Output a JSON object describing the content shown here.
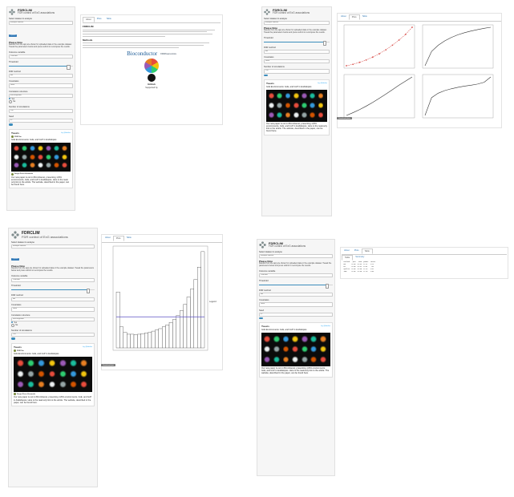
{
  "app": {
    "title": "FDRCLIM",
    "subtitle": "FDR control of ExG associations"
  },
  "sidebar": {
    "dataset_label": "Select dataset to analyse",
    "dataset_value": "Example dataset",
    "upload_button": "Upload",
    "about_heading": "Please Note",
    "about_text": "Results from the app are shown for uploaded data or the example dataset. Tweak the parameters below and press submit to recompute the results.",
    "outcome_label": "Outcome variable",
    "outcome_hint": "Choose the outcome",
    "outcome_value": "Outcome",
    "exposure_label": "Exposure",
    "threshold_label": "Threshold",
    "threshold_value": "0.05",
    "method_label": "FDR method",
    "method_value": "BH",
    "covariates_label": "Covariates",
    "covariates_value": "None",
    "correlation_label": "Correlation structure",
    "correlation_value": "Exchangeable",
    "radio_yes": "Yes",
    "radio_no": "No",
    "nsim_label": "Number of simulations",
    "nsim_value": "100",
    "seed_label": "Seed",
    "seed_value": "42",
    "toggle_label": "Plot",
    "run_label": "Run"
  },
  "tweets": {
    "header": "Tweets",
    "by": "by @fdrclim",
    "tweet1_name": "FDRClim",
    "tweet1_handle": "@fdrclim",
    "tweet1_text": "GxE Environments: GxE, and GxP in Arabidopsis",
    "tweet1_link": "pubmed.ncbi.nlm.nih.gov",
    "tweet1_meta": "12:00 PM",
    "tweet2_name": "Sergio Perez-Hernando",
    "tweet2_handle": "@sperez",
    "tweet2_text": "Our new paper is out in #FrontGenet, presenting 1,801 environments, GxE, and GxP in Arabidopsis. Here is the read-only link to the article. The website, described in the paper, can be found here."
  },
  "q1": {
    "tabs": [
      "About",
      "Plots",
      "Table"
    ],
    "main_heading": "FDRCLIM",
    "about_h2": "Methods",
    "bioc_label": "Bioconductor",
    "ensembl": "FDRGenomics",
    "citation_heading": "Cite this work",
    "github_label": "GitHub",
    "supported_heading": "Supported by"
  },
  "q2": {
    "tabs": [
      "About",
      "Plots",
      "Table"
    ],
    "download_label": "Download plots"
  },
  "q3": {
    "tabs": [
      "About",
      "Plots",
      "Table"
    ],
    "download_label": "Download plot",
    "legend_title": "Legend"
  },
  "q4": {
    "tabs": [
      "About",
      "Plots",
      "Table"
    ],
    "subtabs": [
      "Table",
      "Summary"
    ],
    "table_rows": [
      "  Method   pi0   FDR  power  nDisc",
      "  BH      0.86  0.04  0.71   124",
      "  BY      0.86  0.01  0.52    88",
      "  qvalue  0.86  0.05  0.74   131",
      "  IHW     0.86  0.05  0.78   140"
    ]
  },
  "chart_data": [
    {
      "type": "line",
      "panel": "top-left",
      "x": [
        0,
        1,
        2,
        3,
        4,
        5,
        6,
        7,
        8,
        9,
        10
      ],
      "y": [
        0,
        0.5,
        1.2,
        2,
        3,
        4.2,
        5.6,
        7.2,
        9,
        11,
        13.5
      ],
      "color": "#d9534f"
    },
    {
      "type": "line",
      "panel": "top-right",
      "x": [
        0,
        1,
        2,
        3,
        4,
        5,
        6,
        7,
        8,
        9,
        10
      ],
      "y": [
        0,
        4.2,
        6,
        7.3,
        8.3,
        9.1,
        9.7,
        10.2,
        10.6,
        11,
        11.3
      ],
      "color": "#333333"
    },
    {
      "type": "line",
      "panel": "bottom-left",
      "x": [
        0,
        1,
        2,
        3,
        4,
        5,
        6,
        7,
        8,
        9,
        10
      ],
      "y": [
        0,
        0.8,
        1.7,
        2.7,
        3.8,
        5,
        6.2,
        7.5,
        8.8,
        10,
        11.2
      ],
      "color": "#333333"
    },
    {
      "type": "line",
      "panel": "bottom-right",
      "x": [
        0,
        1,
        2,
        3,
        4,
        5,
        6,
        7,
        8,
        9,
        10
      ],
      "y": [
        0,
        6,
        7.5,
        8.4,
        9,
        9.5,
        9.9,
        10.2,
        10.6,
        11.2,
        13
      ],
      "color": "#333333"
    },
    {
      "type": "bar",
      "panel": "histogram",
      "categories": [
        "1",
        "2",
        "3",
        "4",
        "5",
        "6",
        "7",
        "8",
        "9",
        "10",
        "11",
        "12",
        "13",
        "14",
        "15",
        "16",
        "17",
        "18",
        "19",
        "20",
        "21",
        "22",
        "23",
        "24",
        "25"
      ],
      "values": [
        0.9,
        0.34,
        0.25,
        0.22,
        0.22,
        0.21,
        0.22,
        0.23,
        0.24,
        0.25,
        0.27,
        0.29,
        0.31,
        0.34,
        0.37,
        0.41,
        0.46,
        0.52,
        0.6,
        0.7,
        0.82,
        0.95,
        1.1,
        1.3,
        1.55
      ],
      "hline": 0.5,
      "ylim": [
        0,
        1.6
      ]
    }
  ]
}
